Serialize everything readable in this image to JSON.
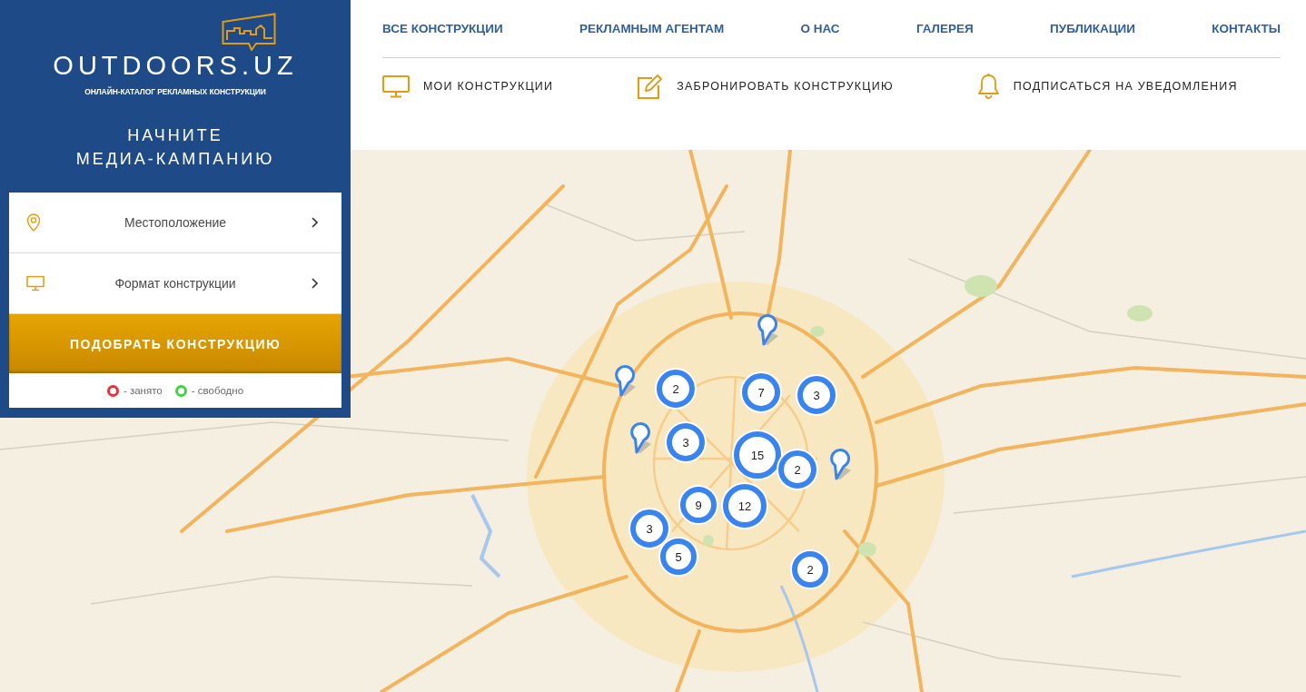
{
  "logo": {
    "text": "OUTDOORS.UZ",
    "tagline": "ОНЛАЙН-КАТАЛОГ РЕКЛАМНЫХ КОНСТРУКЦИИ"
  },
  "headline": [
    "НАЧНИТЕ",
    "МЕДИА-КАМПАНИЮ"
  ],
  "filters": [
    {
      "kind": "location",
      "label": "Местоположение"
    },
    {
      "kind": "format",
      "label": "Формат конструкции"
    }
  ],
  "search_button": "ПОДОБРАТЬ КОНСТРУКЦИЮ",
  "legend": [
    {
      "label": "- занято",
      "color": "#e5323a"
    },
    {
      "label": "- свободно",
      "color": "#3cd63c"
    }
  ],
  "nav": [
    "ВСЕ КОНСТРУКЦИИ",
    "РЕКЛАМНЫМ АГЕНТАМ",
    "О НАС",
    "ГАЛЕРЕЯ",
    "ПУБЛИКАЦИИ",
    "КОНТАКТЫ"
  ],
  "actions": [
    {
      "kind": "monitor",
      "label": "МОИ КОНСТРУКЦИИ"
    },
    {
      "kind": "edit",
      "label": "ЗАБРОНИРОВАТЬ КОНСТРУКЦИЮ"
    },
    {
      "kind": "bell",
      "label": "ПОДПИСАТЬСЯ НА УВЕДОМЛЕНИЯ"
    }
  ],
  "map": {
    "markers": [
      {
        "kind": "pin"
      },
      {
        "kind": "pin"
      },
      {
        "kind": "cluster",
        "count": "2"
      },
      {
        "kind": "cluster",
        "count": "7"
      },
      {
        "kind": "cluster",
        "count": "3"
      },
      {
        "kind": "pin"
      },
      {
        "kind": "cluster",
        "count": "3"
      },
      {
        "kind": "cluster",
        "count": "15"
      },
      {
        "kind": "pin"
      },
      {
        "kind": "cluster",
        "count": "2"
      },
      {
        "kind": "cluster",
        "count": "9"
      },
      {
        "kind": "cluster",
        "count": "12"
      },
      {
        "kind": "cluster",
        "count": "3"
      },
      {
        "kind": "cluster",
        "count": "5"
      },
      {
        "kind": "cluster",
        "count": "2"
      }
    ]
  }
}
